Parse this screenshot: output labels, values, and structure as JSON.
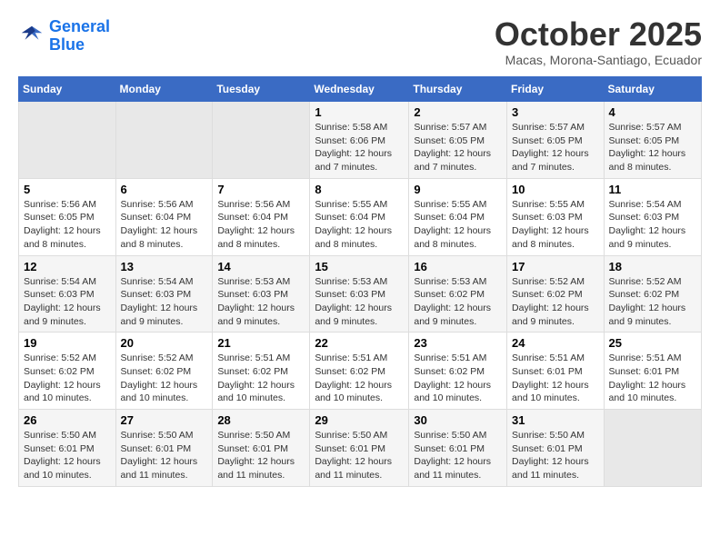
{
  "header": {
    "logo_line1": "General",
    "logo_line2": "Blue",
    "month": "October 2025",
    "location": "Macas, Morona-Santiago, Ecuador"
  },
  "weekdays": [
    "Sunday",
    "Monday",
    "Tuesday",
    "Wednesday",
    "Thursday",
    "Friday",
    "Saturday"
  ],
  "weeks": [
    [
      {
        "day": "",
        "sunrise": "",
        "sunset": "",
        "daylight": ""
      },
      {
        "day": "",
        "sunrise": "",
        "sunset": "",
        "daylight": ""
      },
      {
        "day": "",
        "sunrise": "",
        "sunset": "",
        "daylight": ""
      },
      {
        "day": "1",
        "sunrise": "5:58 AM",
        "sunset": "6:06 PM",
        "daylight": "12 hours and 7 minutes."
      },
      {
        "day": "2",
        "sunrise": "5:57 AM",
        "sunset": "6:05 PM",
        "daylight": "12 hours and 7 minutes."
      },
      {
        "day": "3",
        "sunrise": "5:57 AM",
        "sunset": "6:05 PM",
        "daylight": "12 hours and 7 minutes."
      },
      {
        "day": "4",
        "sunrise": "5:57 AM",
        "sunset": "6:05 PM",
        "daylight": "12 hours and 8 minutes."
      }
    ],
    [
      {
        "day": "5",
        "sunrise": "5:56 AM",
        "sunset": "6:05 PM",
        "daylight": "12 hours and 8 minutes."
      },
      {
        "day": "6",
        "sunrise": "5:56 AM",
        "sunset": "6:04 PM",
        "daylight": "12 hours and 8 minutes."
      },
      {
        "day": "7",
        "sunrise": "5:56 AM",
        "sunset": "6:04 PM",
        "daylight": "12 hours and 8 minutes."
      },
      {
        "day": "8",
        "sunrise": "5:55 AM",
        "sunset": "6:04 PM",
        "daylight": "12 hours and 8 minutes."
      },
      {
        "day": "9",
        "sunrise": "5:55 AM",
        "sunset": "6:04 PM",
        "daylight": "12 hours and 8 minutes."
      },
      {
        "day": "10",
        "sunrise": "5:55 AM",
        "sunset": "6:03 PM",
        "daylight": "12 hours and 8 minutes."
      },
      {
        "day": "11",
        "sunrise": "5:54 AM",
        "sunset": "6:03 PM",
        "daylight": "12 hours and 9 minutes."
      }
    ],
    [
      {
        "day": "12",
        "sunrise": "5:54 AM",
        "sunset": "6:03 PM",
        "daylight": "12 hours and 9 minutes."
      },
      {
        "day": "13",
        "sunrise": "5:54 AM",
        "sunset": "6:03 PM",
        "daylight": "12 hours and 9 minutes."
      },
      {
        "day": "14",
        "sunrise": "5:53 AM",
        "sunset": "6:03 PM",
        "daylight": "12 hours and 9 minutes."
      },
      {
        "day": "15",
        "sunrise": "5:53 AM",
        "sunset": "6:03 PM",
        "daylight": "12 hours and 9 minutes."
      },
      {
        "day": "16",
        "sunrise": "5:53 AM",
        "sunset": "6:02 PM",
        "daylight": "12 hours and 9 minutes."
      },
      {
        "day": "17",
        "sunrise": "5:52 AM",
        "sunset": "6:02 PM",
        "daylight": "12 hours and 9 minutes."
      },
      {
        "day": "18",
        "sunrise": "5:52 AM",
        "sunset": "6:02 PM",
        "daylight": "12 hours and 9 minutes."
      }
    ],
    [
      {
        "day": "19",
        "sunrise": "5:52 AM",
        "sunset": "6:02 PM",
        "daylight": "12 hours and 10 minutes."
      },
      {
        "day": "20",
        "sunrise": "5:52 AM",
        "sunset": "6:02 PM",
        "daylight": "12 hours and 10 minutes."
      },
      {
        "day": "21",
        "sunrise": "5:51 AM",
        "sunset": "6:02 PM",
        "daylight": "12 hours and 10 minutes."
      },
      {
        "day": "22",
        "sunrise": "5:51 AM",
        "sunset": "6:02 PM",
        "daylight": "12 hours and 10 minutes."
      },
      {
        "day": "23",
        "sunrise": "5:51 AM",
        "sunset": "6:02 PM",
        "daylight": "12 hours and 10 minutes."
      },
      {
        "day": "24",
        "sunrise": "5:51 AM",
        "sunset": "6:01 PM",
        "daylight": "12 hours and 10 minutes."
      },
      {
        "day": "25",
        "sunrise": "5:51 AM",
        "sunset": "6:01 PM",
        "daylight": "12 hours and 10 minutes."
      }
    ],
    [
      {
        "day": "26",
        "sunrise": "5:50 AM",
        "sunset": "6:01 PM",
        "daylight": "12 hours and 10 minutes."
      },
      {
        "day": "27",
        "sunrise": "5:50 AM",
        "sunset": "6:01 PM",
        "daylight": "12 hours and 11 minutes."
      },
      {
        "day": "28",
        "sunrise": "5:50 AM",
        "sunset": "6:01 PM",
        "daylight": "12 hours and 11 minutes."
      },
      {
        "day": "29",
        "sunrise": "5:50 AM",
        "sunset": "6:01 PM",
        "daylight": "12 hours and 11 minutes."
      },
      {
        "day": "30",
        "sunrise": "5:50 AM",
        "sunset": "6:01 PM",
        "daylight": "12 hours and 11 minutes."
      },
      {
        "day": "31",
        "sunrise": "5:50 AM",
        "sunset": "6:01 PM",
        "daylight": "12 hours and 11 minutes."
      },
      {
        "day": "",
        "sunrise": "",
        "sunset": "",
        "daylight": ""
      }
    ]
  ]
}
